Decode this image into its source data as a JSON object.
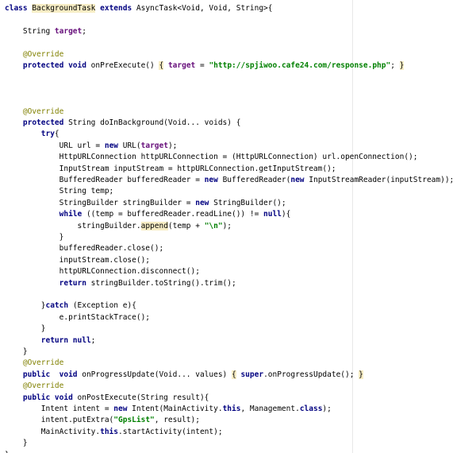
{
  "code": {
    "lines": [
      [
        {
          "t": "class ",
          "c": "kw"
        },
        {
          "t": "BackgroundTask",
          "c": "hl"
        },
        {
          "t": " extends ",
          "c": "kw"
        },
        {
          "t": "AsyncTask<Void, Void, String>{"
        }
      ],
      [],
      [
        {
          "t": "    String "
        },
        {
          "t": "target",
          "c": "fld"
        },
        {
          "t": ";"
        }
      ],
      [],
      [
        {
          "t": "    @Override",
          "c": "ann"
        }
      ],
      [
        {
          "t": "    protected void ",
          "c": "kw"
        },
        {
          "t": "onPreExecute() "
        },
        {
          "t": "{",
          "c": "hl"
        },
        {
          "t": " "
        },
        {
          "t": "target",
          "c": "fld"
        },
        {
          "t": " = "
        },
        {
          "t": "\"http://spjiwoo.cafe24.com/response.php\"",
          "c": "str"
        },
        {
          "t": "; "
        },
        {
          "t": "}",
          "c": "hl"
        }
      ],
      [],
      [],
      [],
      [
        {
          "t": "    @Override",
          "c": "ann"
        }
      ],
      [
        {
          "t": "    protected ",
          "c": "kw"
        },
        {
          "t": "String doInBackground(Void... voids) {"
        }
      ],
      [
        {
          "t": "        try",
          "c": "kw"
        },
        {
          "t": "{"
        }
      ],
      [
        {
          "t": "            URL url = "
        },
        {
          "t": "new ",
          "c": "kw"
        },
        {
          "t": "URL("
        },
        {
          "t": "target",
          "c": "fld"
        },
        {
          "t": ");"
        }
      ],
      [
        {
          "t": "            HttpURLConnection httpURLConnection = (HttpURLConnection) url.openConnection();"
        }
      ],
      [
        {
          "t": "            InputStream inputStream = httpURLConnection.getInputStream();"
        }
      ],
      [
        {
          "t": "            BufferedReader bufferedReader = "
        },
        {
          "t": "new ",
          "c": "kw"
        },
        {
          "t": "BufferedReader("
        },
        {
          "t": "new ",
          "c": "kw"
        },
        {
          "t": "InputStreamReader(inputStream));"
        }
      ],
      [
        {
          "t": "            String temp;"
        }
      ],
      [
        {
          "t": "            StringBuilder stringBuilder = "
        },
        {
          "t": "new ",
          "c": "kw"
        },
        {
          "t": "StringBuilder();"
        }
      ],
      [
        {
          "t": "            while ",
          "c": "kw"
        },
        {
          "t": "((temp = bufferedReader.readLine()) != "
        },
        {
          "t": "null",
          "c": "kw"
        },
        {
          "t": "){"
        }
      ],
      [
        {
          "t": "                stringBuilder."
        },
        {
          "t": "append",
          "c": "hl"
        },
        {
          "t": "(temp + "
        },
        {
          "t": "\"\\n\"",
          "c": "str"
        },
        {
          "t": ");"
        }
      ],
      [
        {
          "t": "            }"
        }
      ],
      [
        {
          "t": "            bufferedReader.close();"
        }
      ],
      [
        {
          "t": "            inputStream.close();"
        }
      ],
      [
        {
          "t": "            httpURLConnection.disconnect();"
        }
      ],
      [
        {
          "t": "            return ",
          "c": "kw"
        },
        {
          "t": "stringBuilder.toString().trim();"
        }
      ],
      [],
      [
        {
          "t": "        }"
        },
        {
          "t": "catch ",
          "c": "kw"
        },
        {
          "t": "(Exception e){"
        }
      ],
      [
        {
          "t": "            e.printStackTrace();"
        }
      ],
      [
        {
          "t": "        }"
        }
      ],
      [
        {
          "t": "        return null",
          "c": "kw"
        },
        {
          "t": ";"
        }
      ],
      [
        {
          "t": "    }"
        }
      ],
      [
        {
          "t": "    @Override",
          "c": "ann"
        }
      ],
      [
        {
          "t": "    public  void ",
          "c": "kw"
        },
        {
          "t": "onProgressUpdate(Void... values) "
        },
        {
          "t": "{",
          "c": "hl"
        },
        {
          "t": " "
        },
        {
          "t": "super",
          "c": "kw"
        },
        {
          "t": ".onProgressUpdate(); "
        },
        {
          "t": "}",
          "c": "hl"
        }
      ],
      [
        {
          "t": "    @Override",
          "c": "ann"
        }
      ],
      [
        {
          "t": "    public void ",
          "c": "kw"
        },
        {
          "t": "onPostExecute(String result){"
        }
      ],
      [
        {
          "t": "        Intent intent = "
        },
        {
          "t": "new ",
          "c": "kw"
        },
        {
          "t": "Intent(MainActivity."
        },
        {
          "t": "this",
          "c": "kw"
        },
        {
          "t": ", Management."
        },
        {
          "t": "class",
          "c": "kw"
        },
        {
          "t": ");"
        }
      ],
      [
        {
          "t": "        intent.putExtra("
        },
        {
          "t": "\"GpsList\"",
          "c": "str"
        },
        {
          "t": ", result);"
        }
      ],
      [
        {
          "t": "        MainActivity."
        },
        {
          "t": "this",
          "c": "kw"
        },
        {
          "t": ".startActivity(intent);"
        }
      ],
      [
        {
          "t": "    }"
        }
      ],
      [
        {
          "t": "}"
        }
      ]
    ]
  }
}
